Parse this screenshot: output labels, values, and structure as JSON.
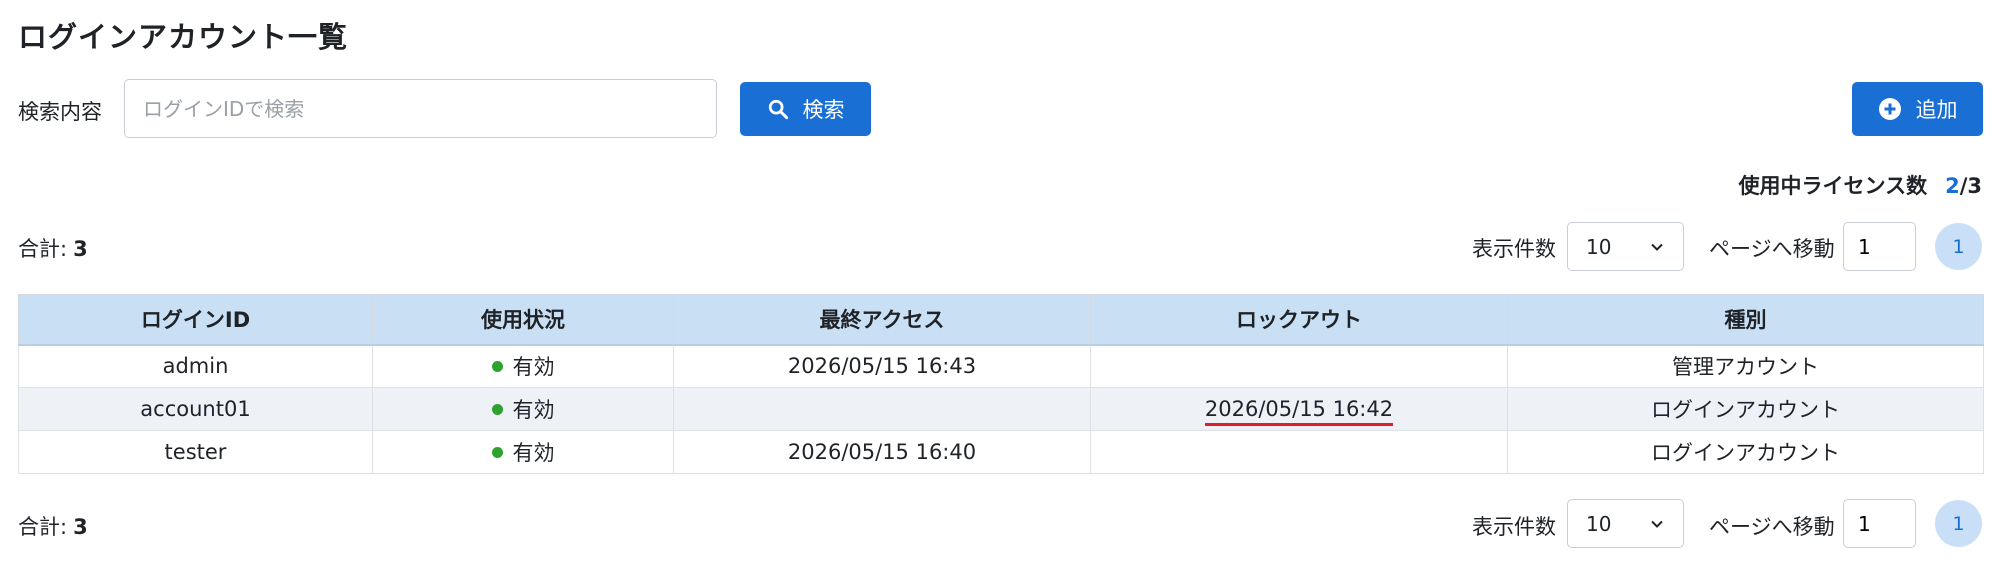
{
  "page": {
    "title": "ログインアカウント一覧"
  },
  "search": {
    "label": "検索内容",
    "placeholder": "ログインIDで検索",
    "value": "",
    "button_label": "検索"
  },
  "toolbar": {
    "add_label": "追加"
  },
  "license": {
    "label": "使用中ライセンス数",
    "used": "2",
    "total": "/3"
  },
  "pagination": {
    "total_label": "合計:",
    "total_count": "3",
    "per_page_label": "表示件数",
    "per_page_value": "10",
    "goto_label": "ページへ移動",
    "goto_value": "1",
    "current_page": "1"
  },
  "table": {
    "columns": [
      "ログインID",
      "使用状況",
      "最終アクセス",
      "ロックアウト",
      "種別"
    ],
    "rows": [
      {
        "login_id": "admin",
        "status": "有効",
        "last_access": "2026/05/15 16:43",
        "lockout": "",
        "type": "管理アカウント"
      },
      {
        "login_id": "account01",
        "status": "有効",
        "last_access": "",
        "lockout": "2026/05/15 16:42",
        "type": "ログインアカウント"
      },
      {
        "login_id": "tester",
        "status": "有効",
        "last_access": "2026/05/15 16:40",
        "lockout": "",
        "type": "ログインアカウント"
      }
    ]
  },
  "colors": {
    "accent": "#1a6fd4",
    "header_bg": "#c8dff4",
    "status_active": "#2ea12e",
    "lockout_highlight": "#e11d2c"
  },
  "icons": {
    "search": "search-icon",
    "add": "plus-circle-icon",
    "dropdown": "chevron-down-icon",
    "status": "status-dot-icon"
  }
}
